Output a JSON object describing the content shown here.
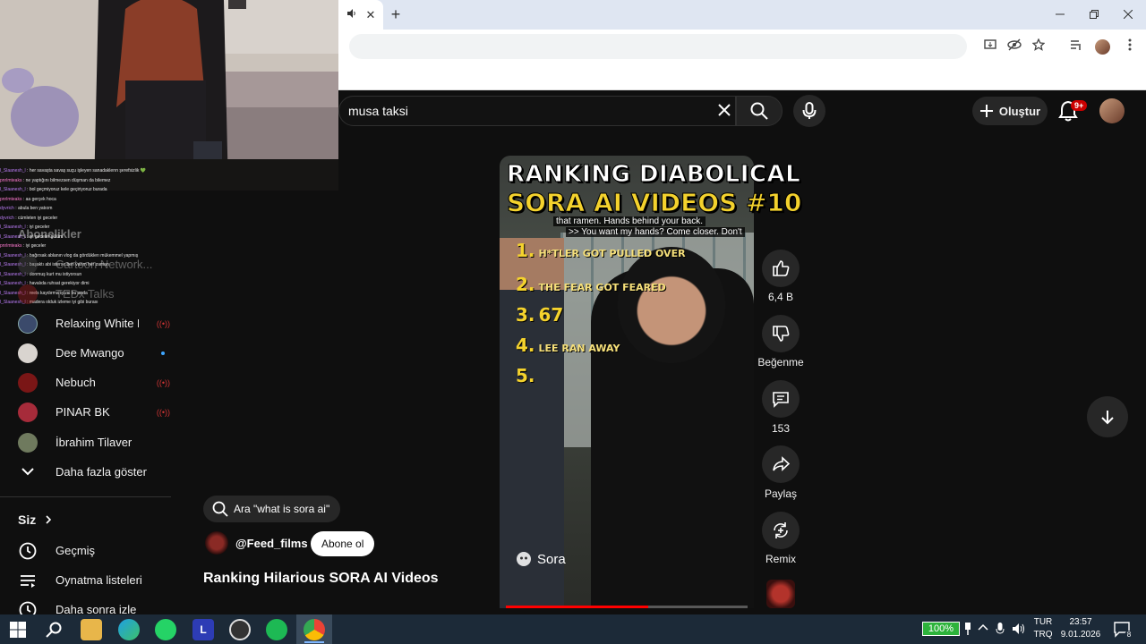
{
  "browser": {
    "tab_audio_icon": "speaker-icon",
    "tab_close": "✕",
    "new_tab": "+"
  },
  "youtube": {
    "search": {
      "query": "musa taksi"
    },
    "create_label": "Oluştur",
    "notification_badge": "9+"
  },
  "chat": [
    {
      "user": "l_Slaanesh_l",
      "msg": "her savaşta savaş suçu işleyen sanadaklerın şerefsizlik 💚"
    },
    {
      "user": "pnrlmteaks",
      "msg": "ne yaptığını bilmezsen düşman da bilemez"
    },
    {
      "user": "l_Slaanesh_l",
      "msg": "bol geçmiyoruz kele geçiriyoruz burada"
    },
    {
      "user": "pnrlmteaks",
      "msg": "aa gerçek hoca"
    },
    {
      "user": "dyvrich",
      "msg": "abula ben yatıom"
    },
    {
      "user": "dyvrich",
      "msg": "cümleten iyi geceler"
    },
    {
      "user": "l_Slaanesh_l",
      "msg": "iyi geceler"
    },
    {
      "user": "l_Slaanesh_l",
      "msg": "iyi geceler gülüm"
    },
    {
      "user": "pnrlmteaks",
      "msg": "iyi geceler"
    },
    {
      "user": "l_Slaanesh_l",
      "msg": "bağırsak ablanın vlog da gördüklerı mükemmel yapmış"
    },
    {
      "user": "l_Slaanesh_l",
      "msg": "başaktı abi isterse ben varım her zaman"
    },
    {
      "user": "l_Slaanesh_l",
      "msg": "donmuş kurt mu istiyorsun"
    },
    {
      "user": "l_Slaanesh_l",
      "msg": "havalıda ruhsat gerekiyor dimi"
    },
    {
      "user": "l_Slaanesh_l",
      "msg": "reels kaydırma işi mi bu anda"
    },
    {
      "user": "l_Slaanesh_l",
      "msg": "madera olduk izleme iyi gibi burası"
    }
  ],
  "sidebar": {
    "hidden_items": [
      {
        "label": "Abonelikler"
      },
      {
        "label": "Cartoon Network..."
      },
      {
        "label": "TEDx Talks"
      }
    ],
    "items": [
      {
        "label": "Relaxing White N...",
        "status": "live"
      },
      {
        "label": "Dee Mwango",
        "status": "new"
      },
      {
        "label": "Nebuch",
        "status": "live"
      },
      {
        "label": "PINAR BK",
        "status": "live"
      },
      {
        "label": "İbrahim Tilaver",
        "status": ""
      }
    ],
    "show_more": "Daha fazla göster",
    "you_section": "Siz",
    "you_items": [
      {
        "label": "Geçmiş",
        "icon": "history-icon"
      },
      {
        "label": "Oynatma listeleri",
        "icon": "playlist-icon"
      },
      {
        "label": "Daha sonra izle",
        "icon": "watch-later-icon"
      }
    ]
  },
  "short": {
    "overlay_title_1": "RANKING DIABOLICAL",
    "overlay_title_2": "SORA AI VIDEOS #10",
    "caption_1": "that ramen. Hands behind your back.",
    "caption_2": ">> You want my hands? Come closer. Don't",
    "rankings": [
      {
        "num": "1.",
        "text": "H*TLER GOT PULLED OVER"
      },
      {
        "num": "2.",
        "text": "THE FEAR GOT FEARED"
      },
      {
        "num": "3.",
        "text": "67"
      },
      {
        "num": "4.",
        "text": "LEE RAN AWAY"
      },
      {
        "num": "5.",
        "text": ""
      }
    ],
    "watermark": "Sora",
    "progress": 0.59
  },
  "actions": {
    "like_count": "6,4 B",
    "dislike_label": "Beğenme",
    "comment_count": "153",
    "share_label": "Paylaş",
    "remix_label": "Remix"
  },
  "info": {
    "search_chip": "Ara \"what is sora ai\"",
    "channel": "@Feed_films",
    "subscribe": "Abone ol",
    "title": "Ranking Hilarious SORA AI Videos"
  },
  "taskbar": {
    "launcher_label": "L",
    "battery": "100%",
    "lang_1": "TUR",
    "lang_2": "TRQ",
    "time": "23:57",
    "date": "9.01.2026",
    "notif_count": "8"
  },
  "colors": {
    "accent_red": "#ff0000",
    "overlay_yellow": "#f4d22d",
    "taskbar": "#1c2a38"
  }
}
